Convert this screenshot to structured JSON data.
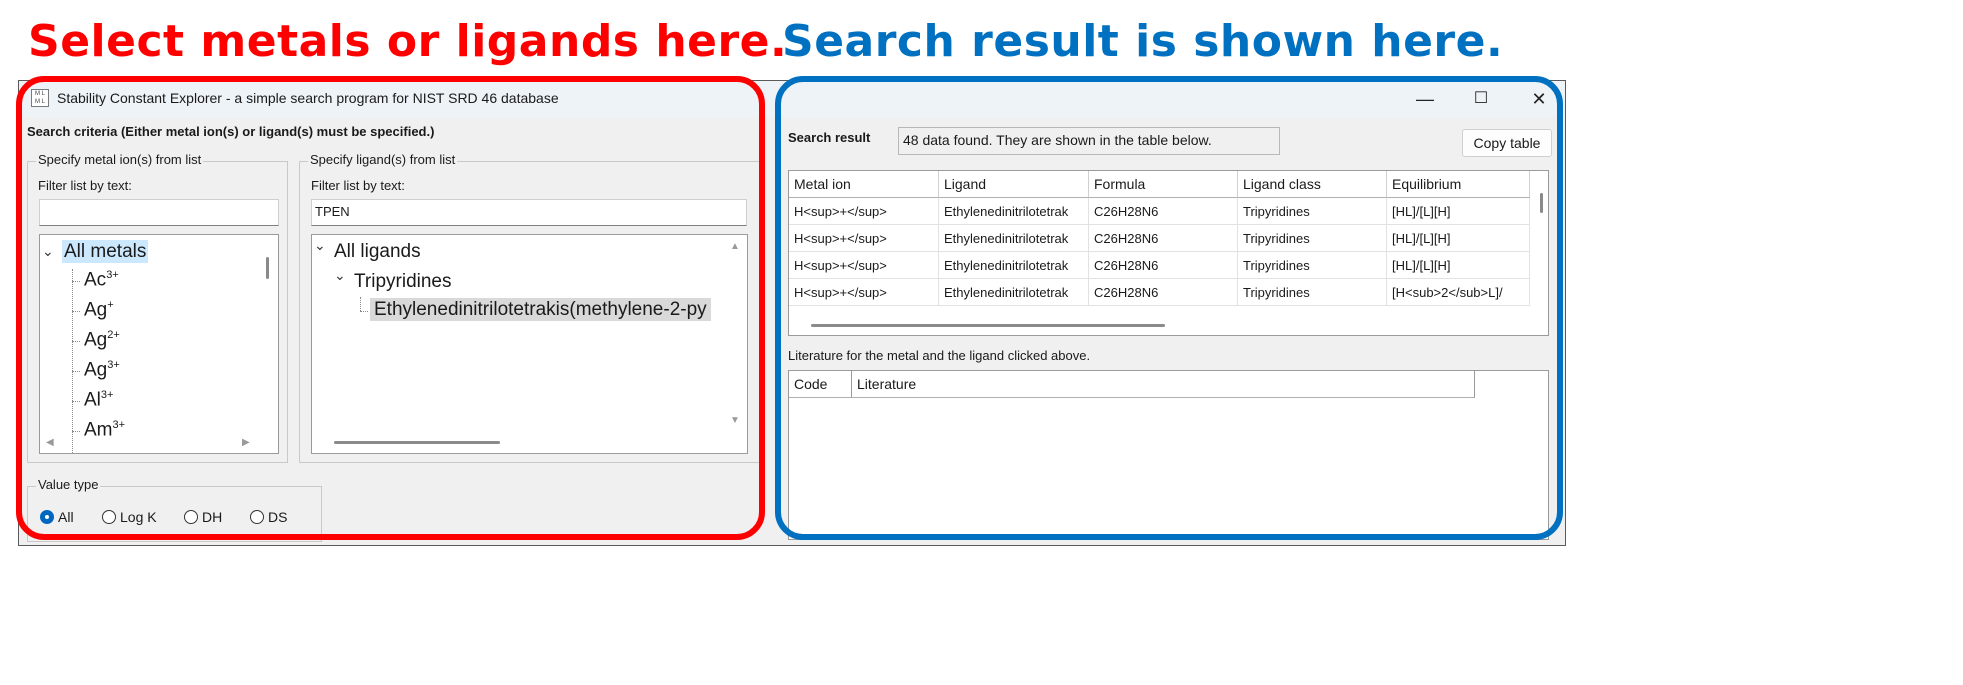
{
  "annotations": {
    "left_headline": "Select metals or ligands here.",
    "right_headline": "Search result is shown here.",
    "left_color": "#ff0000",
    "right_color": "#0070c0"
  },
  "window": {
    "icon": "ml-app-icon",
    "title": "Stability Constant Explorer - a simple search program for NIST SRD 46 database",
    "buttons": {
      "minimize": "—",
      "maximize": "☐",
      "close": "✕"
    }
  },
  "search": {
    "criteria_label": "Search criteria (Either metal ion(s) or ligand(s) must be specified.)",
    "metal_group": {
      "caption": "Specify metal ion(s) from list",
      "filter_label": "Filter list by text:",
      "filter_value": "",
      "root": "All metals",
      "items": [
        {
          "base": "Ac",
          "charge": "3+"
        },
        {
          "base": "Ag",
          "charge": "+"
        },
        {
          "base": "Ag",
          "charge": "2+"
        },
        {
          "base": "Ag",
          "charge": "3+"
        },
        {
          "base": "Al",
          "charge": "3+"
        },
        {
          "base": "Am",
          "charge": "3+"
        }
      ]
    },
    "ligand_group": {
      "caption": "Specify ligand(s) from list",
      "filter_label": "Filter list by text:",
      "filter_value": "TPEN",
      "root": "All ligands",
      "class": "Tripyridines",
      "selected_ligand": "Ethylenedinitrilotetrakis(methylene-2-py"
    },
    "value_type": {
      "caption": "Value type",
      "options": [
        "All",
        "Log K",
        "DH",
        "DS"
      ],
      "selected": "All"
    }
  },
  "result": {
    "label": "Search result",
    "status": "48 data found. They are shown in the table below.",
    "copy_button": "Copy table",
    "columns": [
      "Metal ion",
      "Ligand",
      "Formula",
      "Ligand class",
      "Equilibrium"
    ],
    "rows": [
      [
        "H<sup>+</sup>",
        "Ethylenedinitrilotetrak",
        "C26H28N6",
        "Tripyridines",
        "[HL]/[L][H]"
      ],
      [
        "H<sup>+</sup>",
        "Ethylenedinitrilotetrak",
        "C26H28N6",
        "Tripyridines",
        "[HL]/[L][H]"
      ],
      [
        "H<sup>+</sup>",
        "Ethylenedinitrilotetrak",
        "C26H28N6",
        "Tripyridines",
        "[HL]/[L][H]"
      ],
      [
        "H<sup>+</sup>",
        "Ethylenedinitrilotetrak",
        "C26H28N6",
        "Tripyridines",
        "[H<sub>2</sub>L]/"
      ]
    ],
    "literature_label": "Literature for the metal and the ligand clicked above.",
    "literature_columns": [
      "Code",
      "Literature"
    ]
  }
}
